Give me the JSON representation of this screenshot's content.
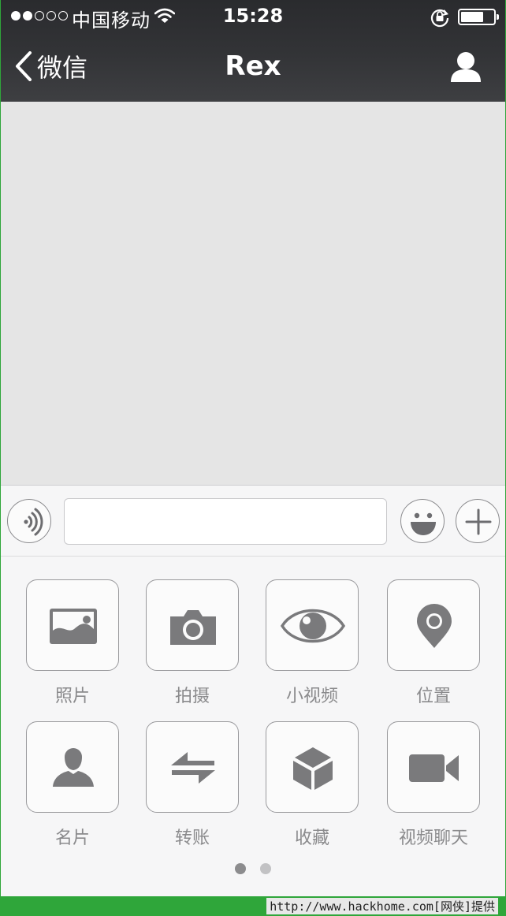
{
  "status_bar": {
    "carrier": "中国移动",
    "time": "15:28",
    "signal_bars_filled": 2,
    "signal_bars_total": 5
  },
  "nav": {
    "back_label": "微信",
    "title": "Rex"
  },
  "input": {
    "value": "",
    "placeholder": ""
  },
  "panel": {
    "items": [
      {
        "label": "照片",
        "icon": "photo-icon"
      },
      {
        "label": "拍摄",
        "icon": "camera-icon"
      },
      {
        "label": "小视频",
        "icon": "eye-icon"
      },
      {
        "label": "位置",
        "icon": "location-pin-icon"
      },
      {
        "label": "名片",
        "icon": "person-card-icon"
      },
      {
        "label": "转账",
        "icon": "transfer-arrows-icon"
      },
      {
        "label": "收藏",
        "icon": "box-icon"
      },
      {
        "label": "视频聊天",
        "icon": "video-camera-icon"
      }
    ],
    "page_current": 1,
    "page_count": 2
  },
  "watermark": {
    "text": "http://www.hackhome.com[网侠]提供"
  },
  "colors": {
    "nav_bg": "#333437",
    "screen_bg": "#e5e5e5",
    "panel_bg": "#f6f6f7",
    "icon_gray": "#7a7a7c",
    "pager_active": "#8c8c8e",
    "pager_inactive": "#c2c2c4",
    "frame_green": "#2fa63a"
  }
}
